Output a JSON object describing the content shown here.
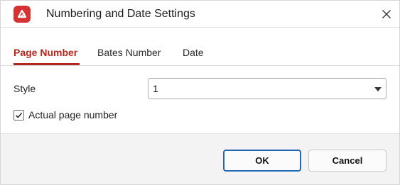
{
  "window": {
    "title": "Numbering and Date Settings",
    "app_icon": "app-logo-icon",
    "close_icon": "close-icon"
  },
  "tabs": [
    {
      "label": "Page Number",
      "active": true
    },
    {
      "label": "Bates Number",
      "active": false
    },
    {
      "label": "Date",
      "active": false
    }
  ],
  "form": {
    "style_label": "Style",
    "style_value": "1",
    "actual_page_number_label": "Actual page number",
    "actual_page_number_checked": true
  },
  "footer": {
    "ok_label": "OK",
    "cancel_label": "Cancel"
  },
  "colors": {
    "accent": "#b3261e",
    "app_icon_bg": "#d73232",
    "primary_border": "#1f67b1"
  }
}
